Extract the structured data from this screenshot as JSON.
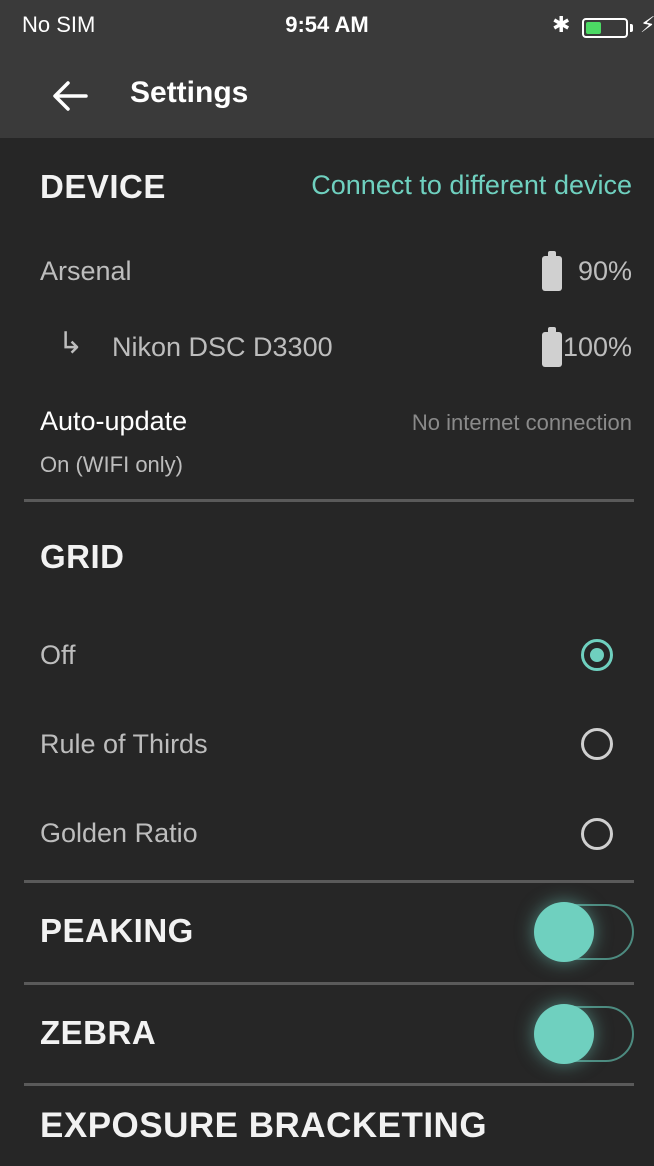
{
  "status_bar": {
    "carrier": "No SIM",
    "time": "9:54 AM",
    "bluetooth_icon": "bluetooth-icon",
    "battery_level": 0.4,
    "battery_color": "#4cd964"
  },
  "app_bar": {
    "title": "Settings",
    "back_icon": "arrow-left-icon"
  },
  "accent_color": "#6fd0bf",
  "device": {
    "title": "DEVICE",
    "connect_link": "Connect to different device",
    "devices": [
      {
        "name": "Arsenal",
        "battery": "90%"
      },
      {
        "prefix": "↳",
        "name": "Nikon DSC D3300",
        "battery": "100%"
      }
    ],
    "auto_update": {
      "label": "Auto-update",
      "value": "On (WIFI only)",
      "status": "No internet connection"
    }
  },
  "grid": {
    "title": "GRID",
    "options": [
      {
        "label": "Off",
        "selected": true
      },
      {
        "label": "Rule of Thirds",
        "selected": false
      },
      {
        "label": "Golden Ratio",
        "selected": false
      }
    ]
  },
  "peaking": {
    "title": "PEAKING",
    "enabled": true
  },
  "zebra": {
    "title": "ZEBRA",
    "enabled": true
  },
  "exposure_bracketing": {
    "title": "EXPOSURE BRACKETING"
  }
}
